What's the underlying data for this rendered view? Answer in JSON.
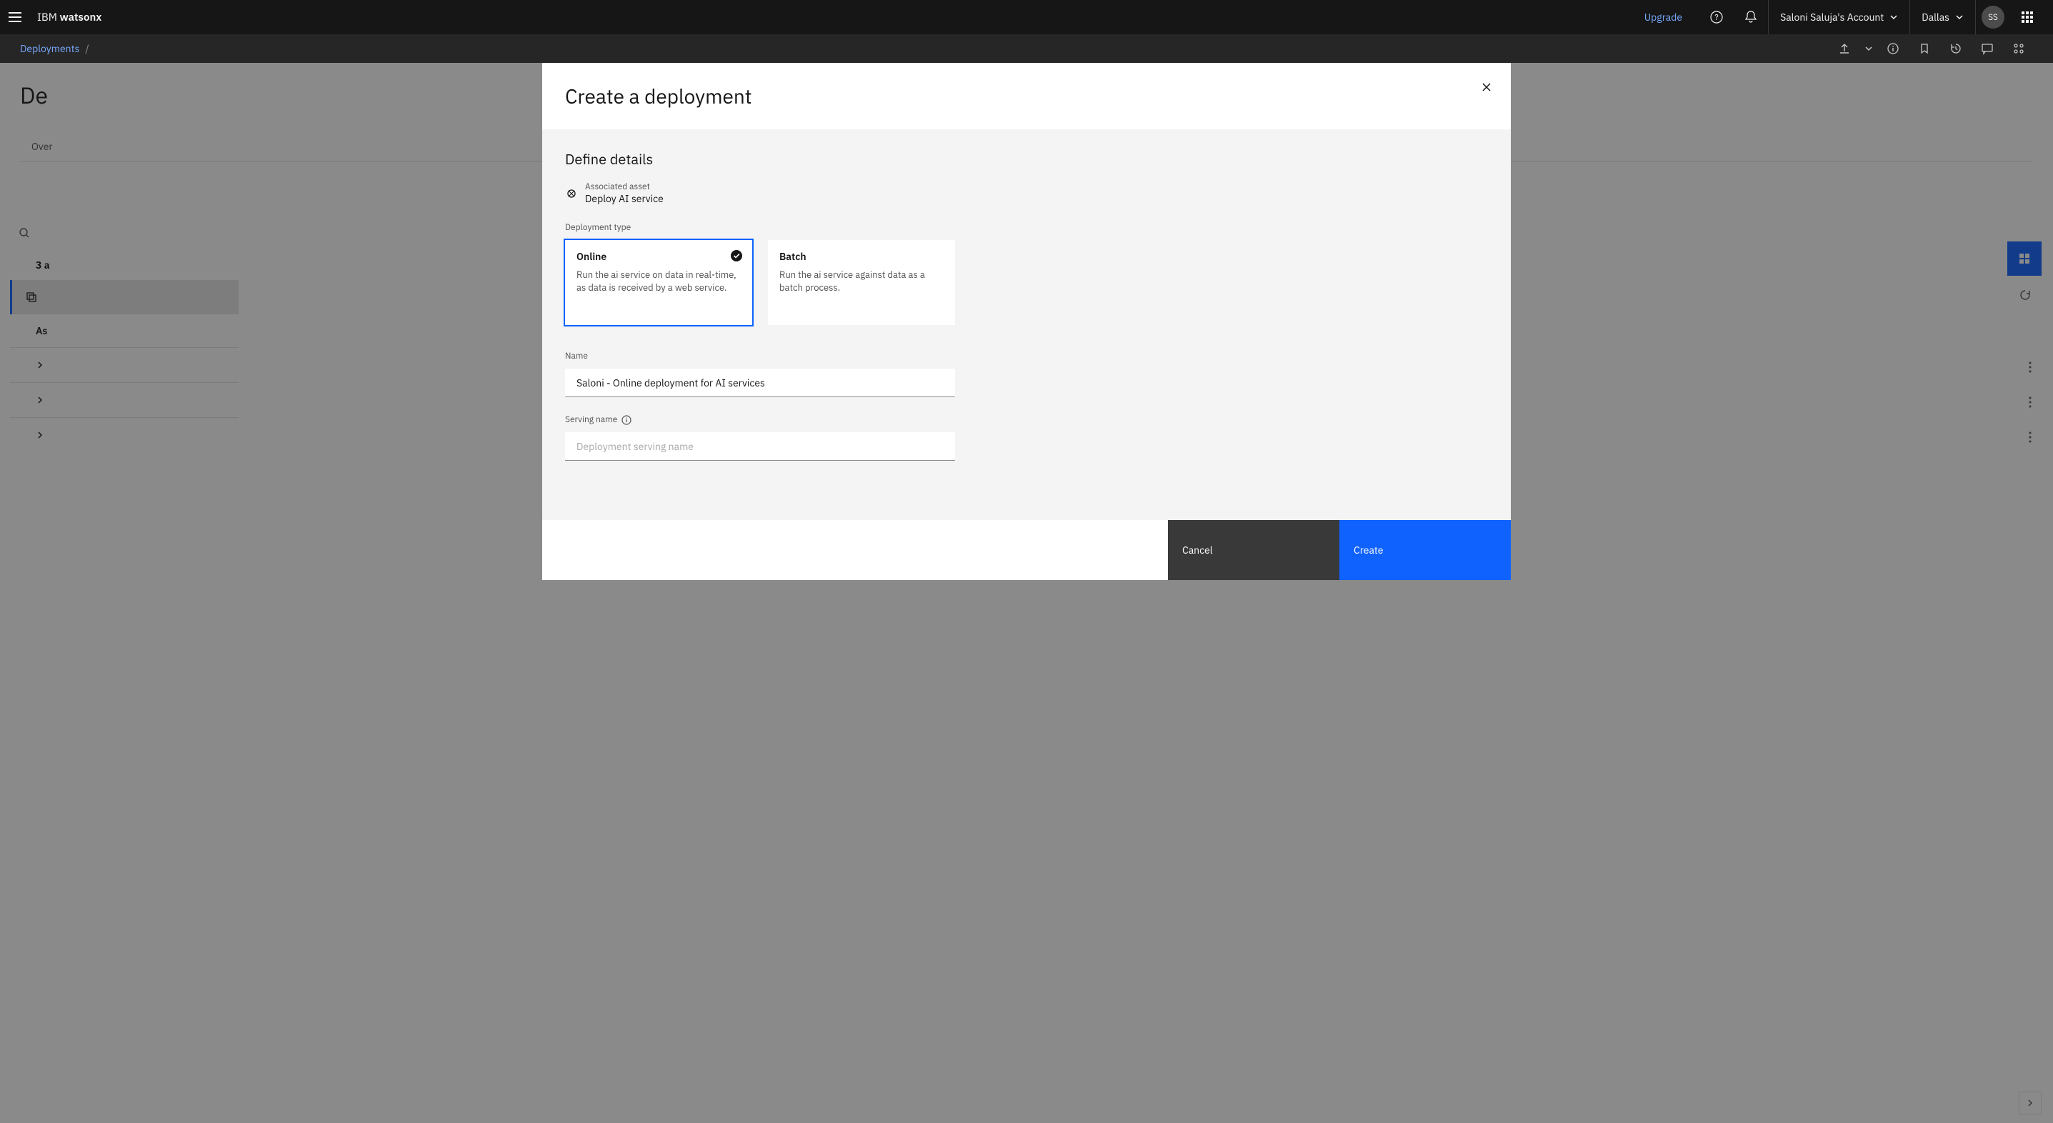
{
  "header": {
    "brand_prefix": "IBM ",
    "brand_name": "watsonx",
    "upgrade": "Upgrade",
    "account": "Saloni Saluja's Account",
    "region": "Dallas",
    "avatar": "SS"
  },
  "subheader": {
    "breadcrumb": "Deployments",
    "separator": "/"
  },
  "page": {
    "title_partial": "De",
    "tab_partial": "Over",
    "asset_count": "3 a",
    "asset_header": "As"
  },
  "modal": {
    "title": "Create a deployment",
    "section_title": "Define details",
    "associated_label": "Associated asset",
    "associated_value": "Deploy AI service",
    "type_label": "Deployment type",
    "types": {
      "online": {
        "title": "Online",
        "desc": "Run the ai service on data in real-time, as data is received by a web service."
      },
      "batch": {
        "title": "Batch",
        "desc": "Run the ai service against data as a batch process."
      }
    },
    "name_label": "Name",
    "name_value": "Saloni - Online deployment for AI services",
    "serving_label": "Serving name",
    "serving_placeholder": "Deployment serving name",
    "cancel": "Cancel",
    "create": "Create"
  }
}
